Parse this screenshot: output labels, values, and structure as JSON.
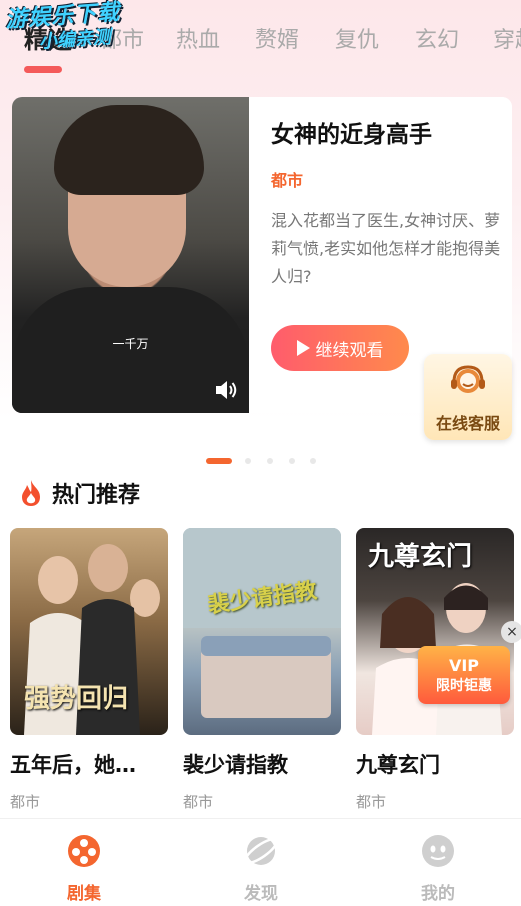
{
  "watermark": {
    "line1": "游娱乐下载",
    "line2": "小编亲测"
  },
  "tabs": [
    {
      "label": "精选",
      "active": true
    },
    {
      "label": "都市",
      "active": false
    },
    {
      "label": "热血",
      "active": false
    },
    {
      "label": "赘婿",
      "active": false
    },
    {
      "label": "复仇",
      "active": false
    },
    {
      "label": "玄幻",
      "active": false
    },
    {
      "label": "穿越",
      "active": false
    }
  ],
  "banner": {
    "poster_caption": "一千万",
    "title": "女神的近身高手",
    "genre": "都市",
    "description": "混入花都当了医生,女神讨厌、萝莉气愤,老实如他怎样才能抱得美人归?",
    "watch_button": "继续观看",
    "slide_count": 5,
    "active_slide": 1
  },
  "customer_service": {
    "label": "在线客服"
  },
  "section": {
    "title": "热门推荐"
  },
  "cards": [
    {
      "title": "五年后，她…",
      "genre": "都市",
      "cover_text": "强势回归"
    },
    {
      "title": "裴少请指教",
      "genre": "都市",
      "cover_text": "裴少请指教"
    },
    {
      "title": "九尊玄门",
      "genre": "都市",
      "cover_text": "九尊玄门"
    }
  ],
  "promo_badge": {
    "top": "VIP",
    "label": "限时钜惠",
    "close": "×"
  },
  "bottom_nav": [
    {
      "label": "剧集",
      "icon": "film-reel-icon",
      "active": true
    },
    {
      "label": "发现",
      "icon": "planet-icon",
      "active": false
    },
    {
      "label": "我的",
      "icon": "profile-face-icon",
      "active": false
    }
  ],
  "colors": {
    "accent": "#f4662f",
    "button_gradient_start": "#ff5c6c",
    "button_gradient_end": "#ff8a4c"
  }
}
